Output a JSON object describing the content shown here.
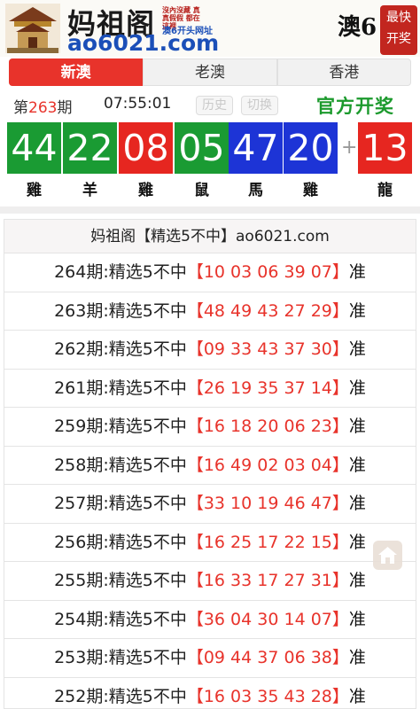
{
  "header": {
    "logo_title": "妈祖阁",
    "logo_slogan": "沒內沒藏 真真假假 都在這裡",
    "logo_url": "ao6021.com",
    "logo_tagline": "澳6开头网址",
    "brand_right": "澳6",
    "seal_text": [
      "最快",
      "开奖"
    ]
  },
  "tabs": [
    {
      "label": "新澳",
      "active": true
    },
    {
      "label": "老澳",
      "active": false
    },
    {
      "label": "香港",
      "active": false
    }
  ],
  "draw": {
    "issue_prefix": "第",
    "issue_number": "263",
    "issue_suffix": "期",
    "time": "07:55:01",
    "history_label": "历史",
    "switch_label": "切换",
    "official_label": "官方开奖",
    "plus_sign": "+",
    "balls": [
      {
        "number": "44",
        "zodiac": "雞",
        "color": "#1a9b33"
      },
      {
        "number": "22",
        "zodiac": "羊",
        "color": "#1a9b33"
      },
      {
        "number": "08",
        "zodiac": "雞",
        "color": "#e62620"
      },
      {
        "number": "05",
        "zodiac": "鼠",
        "color": "#1a9b33"
      },
      {
        "number": "47",
        "zodiac": "馬",
        "color": "#1d34d6"
      },
      {
        "number": "20",
        "zodiac": "雞",
        "color": "#1d34d6"
      }
    ],
    "special_ball": {
      "number": "13",
      "zodiac": "龍",
      "color": "#e62620"
    }
  },
  "predictions": {
    "title": "妈祖阁【精选5不中】ao6021.com",
    "rows": [
      {
        "label": "264期:精选5不中",
        "numbers": "【10 03 06 39 07】",
        "result": "准"
      },
      {
        "label": "263期:精选5不中",
        "numbers": "【48 49 43 27 29】",
        "result": "准"
      },
      {
        "label": "262期:精选5不中",
        "numbers": "【09 33 43 37 30】",
        "result": "准"
      },
      {
        "label": "261期:精选5不中",
        "numbers": "【26 19 35 37 14】",
        "result": "准"
      },
      {
        "label": "259期:精选5不中",
        "numbers": "【16 18 20 06 23】",
        "result": "准"
      },
      {
        "label": "258期:精选5不中",
        "numbers": "【16 49 02 03 04】",
        "result": "准"
      },
      {
        "label": "257期:精选5不中",
        "numbers": "【33 10 19 46 47】",
        "result": "准"
      },
      {
        "label": "256期:精选5不中",
        "numbers": "【16 25 17 22 15】",
        "result": "准"
      },
      {
        "label": "255期:精选5不中",
        "numbers": "【16 33 17 27 31】",
        "result": "准"
      },
      {
        "label": "254期:精选5不中",
        "numbers": "【36 04 30 14 07】",
        "result": "准"
      },
      {
        "label": "253期:精选5不中",
        "numbers": "【09 44 37 06 38】",
        "result": "准"
      },
      {
        "label": "252期:精选5不中",
        "numbers": "【16 03 35 43 28】",
        "result": "准"
      }
    ]
  },
  "home_button_icon": "home-icon"
}
